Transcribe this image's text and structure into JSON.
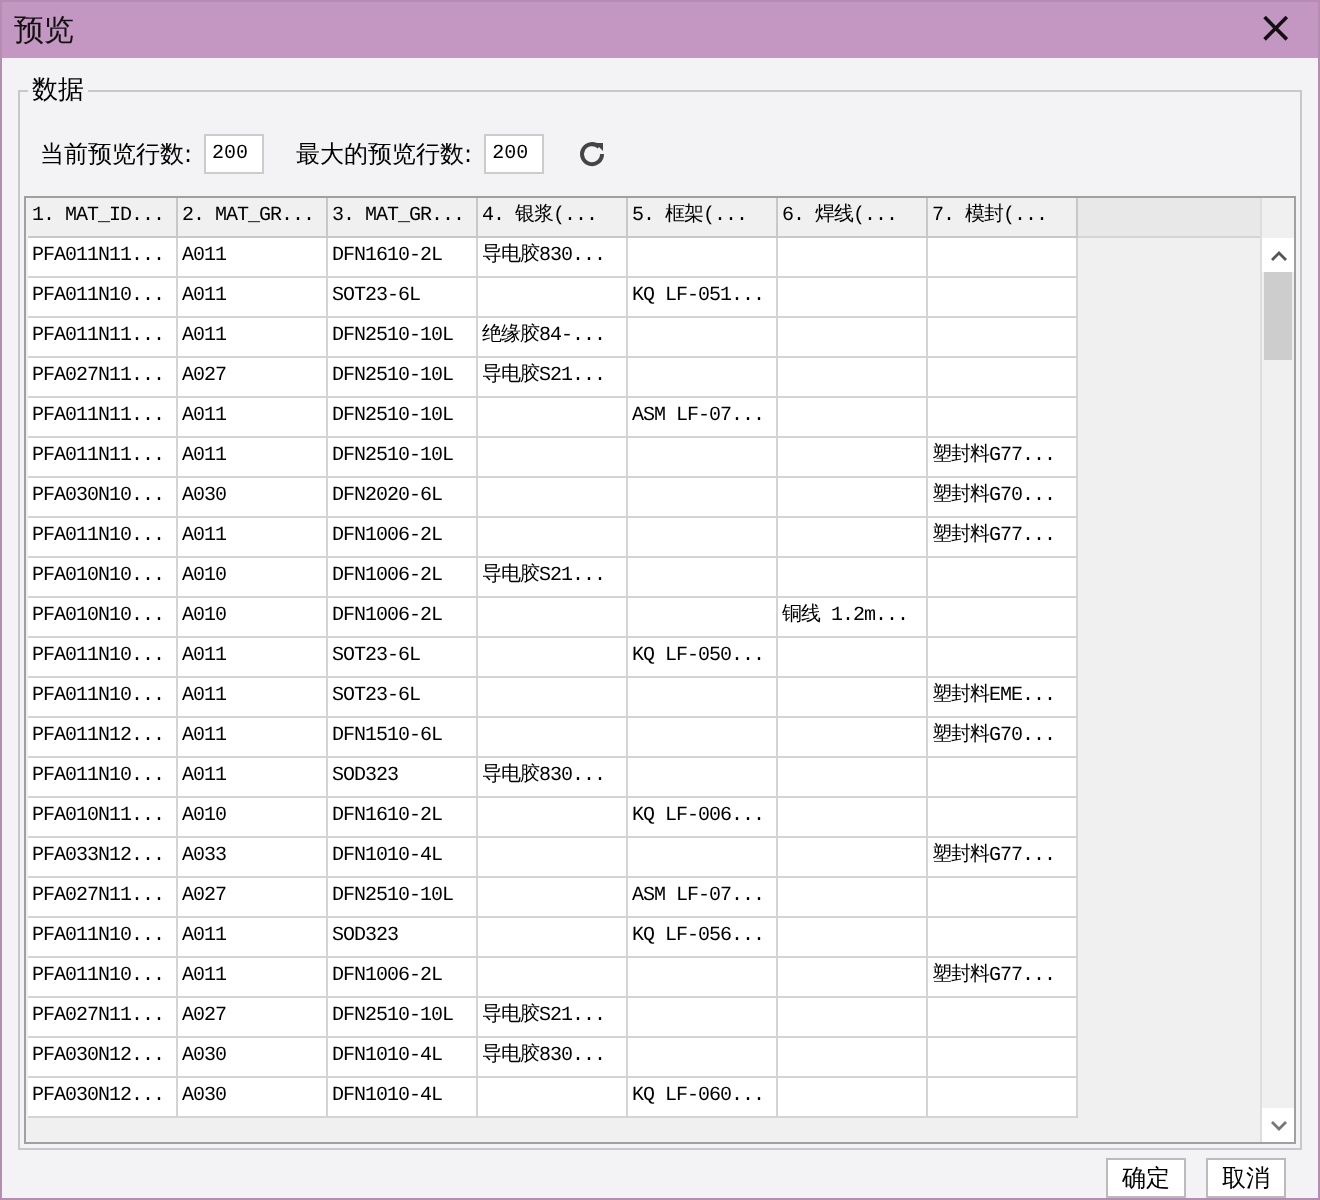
{
  "window": {
    "title": "预览",
    "close": "×"
  },
  "group": {
    "title": "数据"
  },
  "controls": [
    {
      "label": "当前预览行数:",
      "value": "200"
    },
    {
      "label": "最大的预览行数:",
      "value": "200"
    }
  ],
  "table": {
    "columns": [
      "1. MAT_ID...",
      "2. MAT_GR...",
      "3. MAT_GR...",
      "4. 银浆(...",
      "5. 框架(...",
      "6. 焊线(...",
      "7. 模封(..."
    ],
    "rows": [
      [
        "PFA011N11...",
        "A011",
        "DFN1610-2L",
        "导电胶830...",
        null,
        null,
        null
      ],
      [
        "PFA011N10...",
        "A011",
        "SOT23-6L",
        null,
        "KQ LF-051...",
        null,
        null
      ],
      [
        "PFA011N11...",
        "A011",
        "DFN2510-10L",
        "绝缘胶84-...",
        null,
        null,
        null
      ],
      [
        "PFA027N11...",
        "A027",
        "DFN2510-10L",
        "导电胶S21...",
        null,
        null,
        null
      ],
      [
        "PFA011N11...",
        "A011",
        "DFN2510-10L",
        null,
        "ASM LF-07...",
        null,
        null
      ],
      [
        "PFA011N11...",
        "A011",
        "DFN2510-10L",
        null,
        null,
        null,
        "塑封料G77..."
      ],
      [
        "PFA030N10...",
        "A030",
        "DFN2020-6L",
        null,
        null,
        null,
        "塑封料G70..."
      ],
      [
        "PFA011N10...",
        "A011",
        "DFN1006-2L",
        null,
        null,
        null,
        "塑封料G77..."
      ],
      [
        "PFA010N10...",
        "A010",
        "DFN1006-2L",
        "导电胶S21...",
        null,
        null,
        null
      ],
      [
        "PFA010N10...",
        "A010",
        "DFN1006-2L",
        null,
        null,
        "铜线 1.2m...",
        null
      ],
      [
        "PFA011N10...",
        "A011",
        "SOT23-6L",
        null,
        "KQ LF-050...",
        null,
        null
      ],
      [
        "PFA011N10...",
        "A011",
        "SOT23-6L",
        null,
        null,
        null,
        "塑封料EME..."
      ],
      [
        "PFA011N12...",
        "A011",
        "DFN1510-6L",
        null,
        null,
        null,
        "塑封料G70..."
      ],
      [
        "PFA011N10...",
        "A011",
        "SOD323",
        "导电胶830...",
        null,
        null,
        null
      ],
      [
        "PFA010N11...",
        "A010",
        "DFN1610-2L",
        null,
        "KQ LF-006...",
        null,
        null
      ],
      [
        "PFA033N12...",
        "A033",
        "DFN1010-4L",
        null,
        null,
        null,
        "塑封料G77..."
      ],
      [
        "PFA027N11...",
        "A027",
        "DFN2510-10L",
        null,
        "ASM LF-07...",
        null,
        null
      ],
      [
        "PFA011N10...",
        "A011",
        "SOD323",
        null,
        "KQ LF-056...",
        null,
        null
      ],
      [
        "PFA011N10...",
        "A011",
        "DFN1006-2L",
        null,
        null,
        null,
        "塑封料G77..."
      ],
      [
        "PFA027N11...",
        "A027",
        "DFN2510-10L",
        "导电胶S21...",
        null,
        null,
        null
      ],
      [
        "PFA030N12...",
        "A030",
        "DFN1010-4L",
        "导电胶830...",
        null,
        null,
        null
      ],
      [
        "PFA030N12...",
        "A030",
        "DFN1010-4L",
        null,
        "KQ LF-060...",
        null,
        null
      ]
    ]
  },
  "buttons": [
    "确定",
    "取消"
  ]
}
